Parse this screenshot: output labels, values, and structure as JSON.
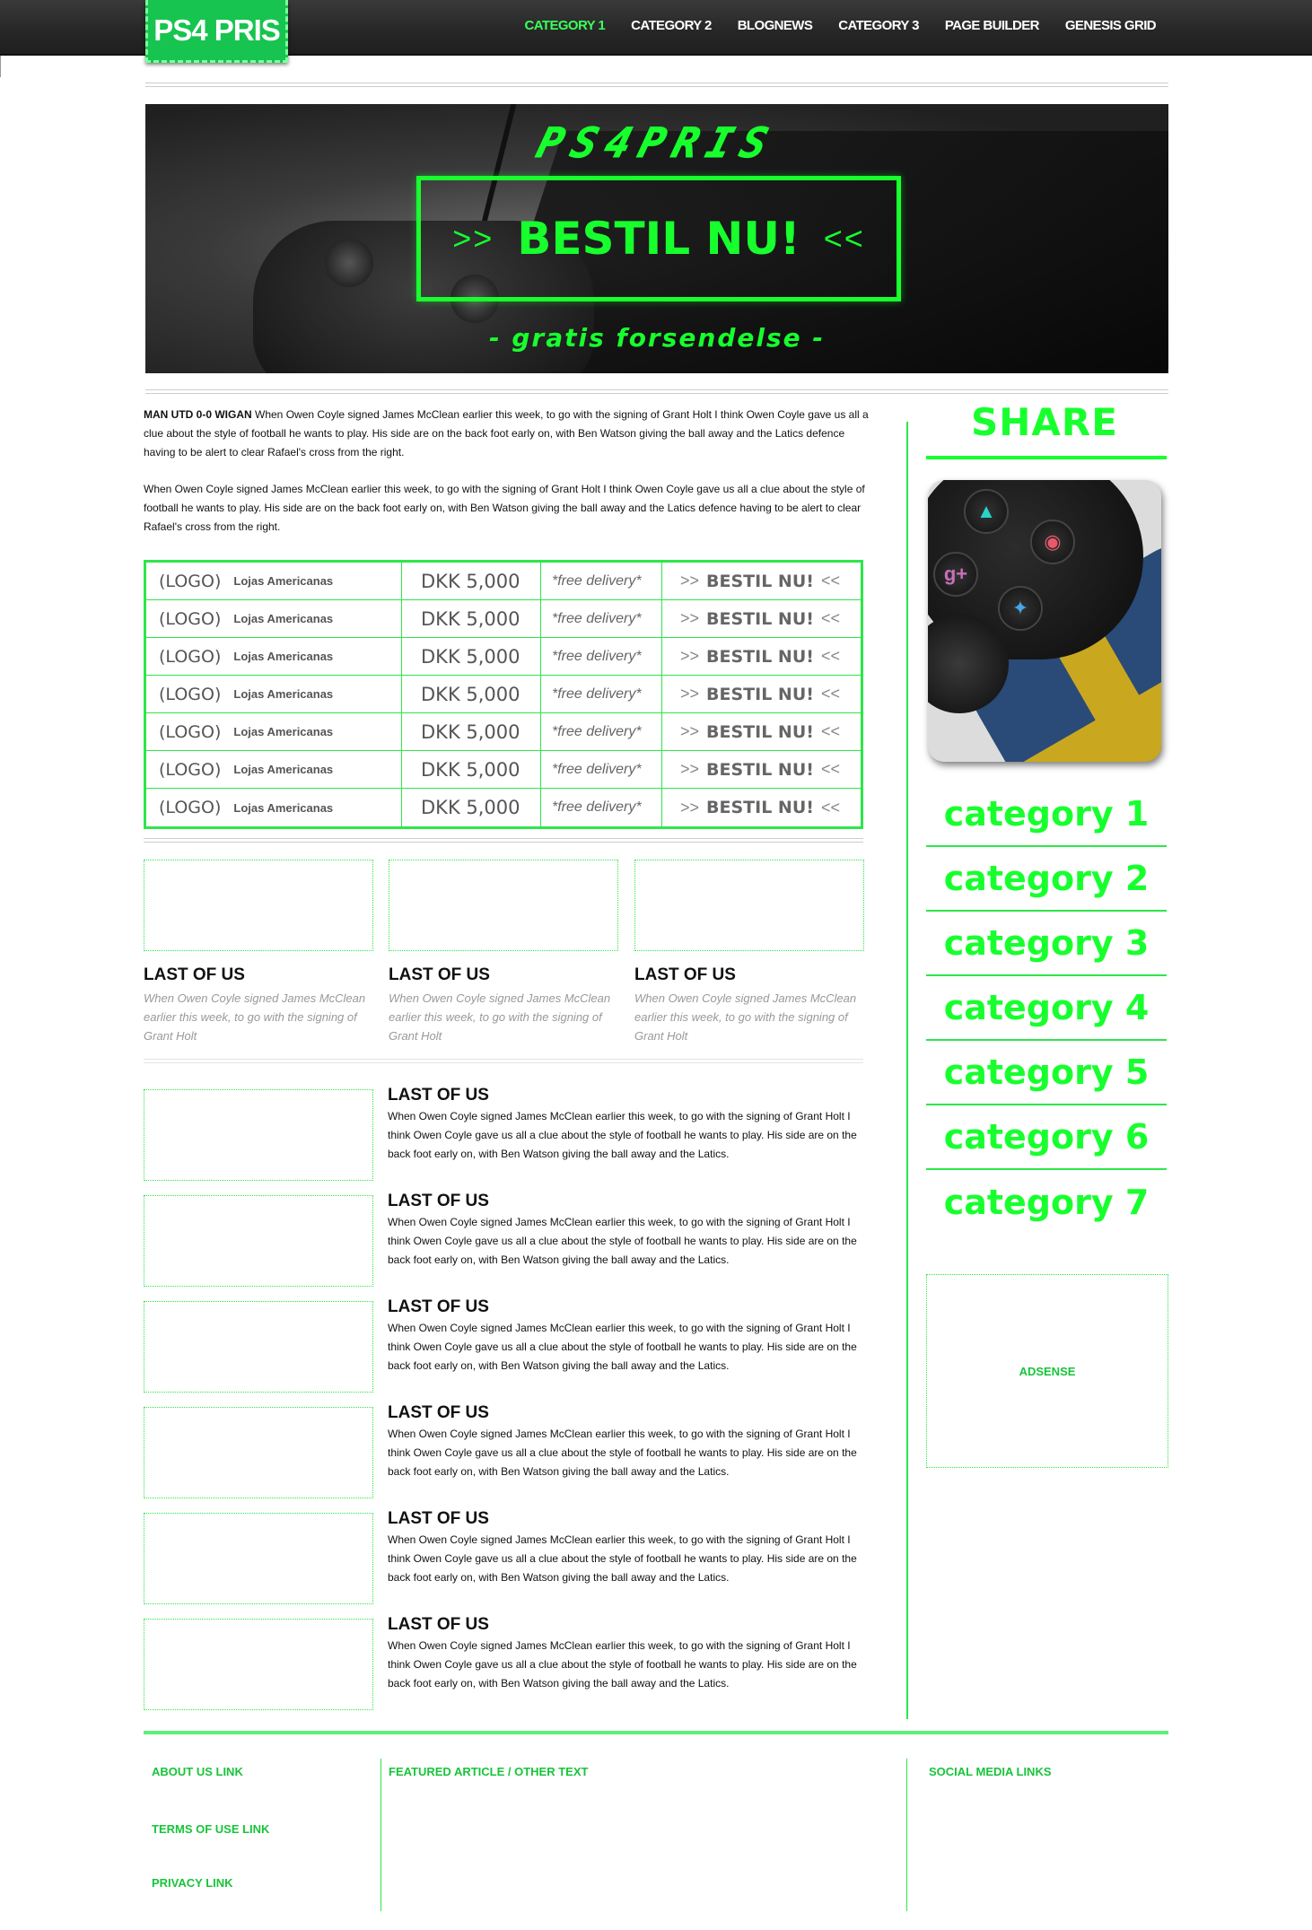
{
  "header": {
    "logo": "PS4 PRIS",
    "nav": [
      "CATEGORY 1",
      "CATEGORY 2",
      "BLOGNEWS",
      "CATEGORY 3",
      "PAGE BUILDER",
      "GENESIS GRID"
    ]
  },
  "banner": {
    "title": "PS4PRIS",
    "cta": "BESTIL NU!",
    "arrows_left": ">>",
    "arrows_right": "<<",
    "subtitle": "- gratis forsendelse -"
  },
  "article": {
    "lead_bold": "MAN UTD 0-0 WIGAN",
    "lead_text": " When Owen Coyle signed James McClean earlier this week, to go with the signing of Grant Holt I think Owen Coyle gave us all a clue about the style of football he wants to play. His side are on the back foot early on, with Ben Watson giving the ball away and the Latics defence having to be alert to clear Rafael's cross from the right.",
    "para2": "When Owen Coyle signed James McClean earlier this week, to go with the signing of Grant Holt I think Owen Coyle gave us all a clue about the style of football he wants to play. His side are on the back foot early on, with Ben Watson giving the ball away and the Latics defence having to be alert to clear Rafael's cross from the right."
  },
  "prices": {
    "rows": [
      {
        "logo": "(LOGO)",
        "shop": "Lojas Americanas",
        "price": "DKK 5,000",
        "delivery": "*free delivery*",
        "cta": "BESTIL NU!"
      },
      {
        "logo": "(LOGO)",
        "shop": "Lojas Americanas",
        "price": "DKK 5,000",
        "delivery": "*free delivery*",
        "cta": "BESTIL NU!"
      },
      {
        "logo": "(LOGO)",
        "shop": "Lojas Americanas",
        "price": "DKK 5,000",
        "delivery": "*free delivery*",
        "cta": "BESTIL NU!"
      },
      {
        "logo": "(LOGO)",
        "shop": "Lojas Americanas",
        "price": "DKK 5,000",
        "delivery": "*free delivery*",
        "cta": "BESTIL NU!"
      },
      {
        "logo": "(LOGO)",
        "shop": "Lojas Americanas",
        "price": "DKK 5,000",
        "delivery": "*free delivery*",
        "cta": "BESTIL NU!"
      },
      {
        "logo": "(LOGO)",
        "shop": "Lojas Americanas",
        "price": "DKK 5,000",
        "delivery": "*free delivery*",
        "cta": "BESTIL NU!"
      },
      {
        "logo": "(LOGO)",
        "shop": "Lojas Americanas",
        "price": "DKK 5,000",
        "delivery": "*free delivery*",
        "cta": "BESTIL NU!"
      }
    ]
  },
  "cards": [
    {
      "title": "LAST OF US",
      "text": "When Owen Coyle signed James McClean earlier this week, to go with the signing of Grant Holt"
    },
    {
      "title": "LAST OF US",
      "text": "When Owen Coyle signed James McClean earlier this week, to go with the signing of Grant Holt"
    },
    {
      "title": "LAST OF US",
      "text": "When Owen Coyle signed James McClean earlier this week, to go with the signing of Grant Holt"
    }
  ],
  "list": [
    {
      "title": "LAST OF US",
      "text": "When Owen Coyle signed James McClean earlier this week, to go with the signing of Grant Holt I think Owen Coyle gave us all a clue about the style of football he wants to play. His side are on the back foot early on, with Ben Watson giving the ball away and the Latics."
    },
    {
      "title": "LAST OF US",
      "text": "When Owen Coyle signed James McClean earlier this week, to go with the signing of Grant Holt I think Owen Coyle gave us all a clue about the style of football he wants to play. His side are on the back foot early on, with Ben Watson giving the ball away and the Latics."
    },
    {
      "title": "LAST OF US",
      "text": "When Owen Coyle signed James McClean earlier this week, to go with the signing of Grant Holt I think Owen Coyle gave us all a clue about the style of football he wants to play. His side are on the back foot early on, with Ben Watson giving the ball away and the Latics."
    },
    {
      "title": "LAST OF US",
      "text": "When Owen Coyle signed James McClean earlier this week, to go with the signing of Grant Holt I think Owen Coyle gave us all a clue about the style of football he wants to play. His side are on the back foot early on, with Ben Watson giving the ball away and the Latics."
    },
    {
      "title": "LAST OF US",
      "text": "When Owen Coyle signed James McClean earlier this week, to go with the signing of Grant Holt I think Owen Coyle gave us all a clue about the style of football he wants to play. His side are on the back foot early on, with Ben Watson giving the ball away and the Latics."
    },
    {
      "title": "LAST OF US",
      "text": "When Owen Coyle signed James McClean earlier this week, to go with the signing of Grant Holt I think Owen Coyle gave us all a clue about the style of football he wants to play. His side are on the back foot early on, with Ben Watson giving the ball away and the Latics."
    }
  ],
  "sidebar": {
    "share_title": "SHARE",
    "share_icons": [
      "vine-icon",
      "pinterest-icon",
      "google-plus-icon",
      "twitter-icon"
    ],
    "categories": [
      "category 1",
      "category 2",
      "category 3",
      "category 4",
      "category 5",
      "category 6",
      "category 7"
    ],
    "adsense": "ADSENSE"
  },
  "footer": {
    "about": "ABOUT US LINK",
    "terms": "TERMS OF USE LINK",
    "privacy": "PRIVACY LINK",
    "featured": "FEATURED ARTICLE / OTHER TEXT",
    "social": "SOCIAL MEDIA LINKS"
  },
  "colors": {
    "accent": "#18ff2e",
    "accent_dark": "#18c43a",
    "logo_bg": "#17c44f",
    "nav_bg": "#262626"
  }
}
